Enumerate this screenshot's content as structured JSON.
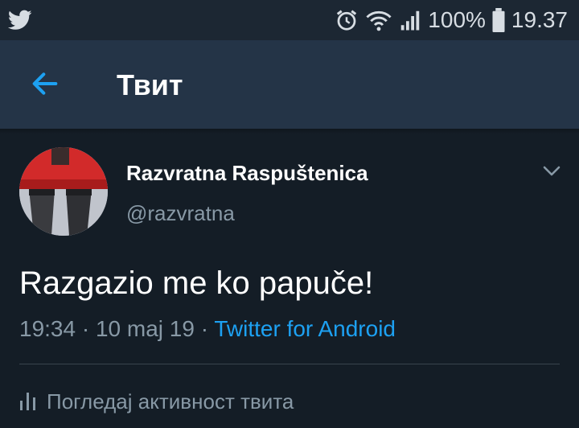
{
  "status_bar": {
    "battery_percent": "100%",
    "time": "19.37",
    "icons": [
      "twitter-bird-icon",
      "alarm-icon",
      "wifi-icon",
      "signal-icon",
      "battery-icon"
    ]
  },
  "app_bar": {
    "back_icon": "arrow-left-icon",
    "title": "Твит",
    "accent_color": "#1da1f2"
  },
  "tweet": {
    "author_name": "Razvratna Raspuštenica",
    "author_handle": "@razvratna",
    "text": "Razgazio me ko papuče!",
    "time": "19:34",
    "separator1": "·",
    "date": "10 maj 19",
    "separator2": "·",
    "source": "Twitter for Android",
    "activity_label": "Погледај активност твита"
  }
}
